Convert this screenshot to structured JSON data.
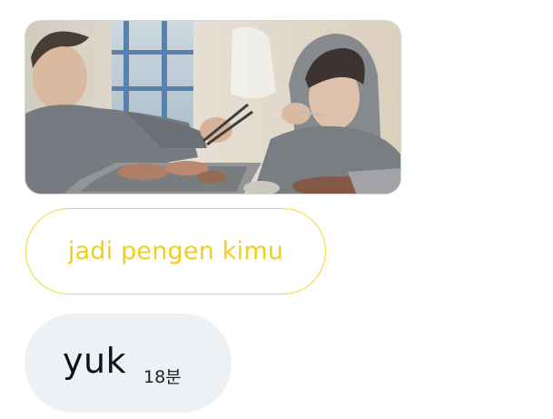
{
  "messages": [
    {
      "type": "photo",
      "alt": ""
    },
    {
      "type": "text",
      "style": "outlined",
      "text": "jadi pengen kimu",
      "accent_color": "#f0cf1a"
    },
    {
      "type": "text",
      "style": "filled",
      "text": "yuk",
      "time": "18분",
      "bubble_color": "#eef1f4"
    }
  ]
}
